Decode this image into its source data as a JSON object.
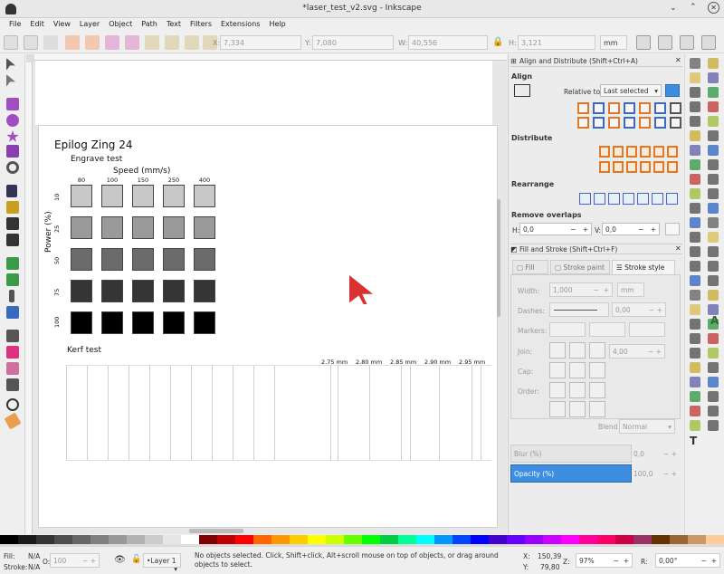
{
  "window": {
    "title": "*laser_test_v2.svg - Inkscape"
  },
  "menu": [
    "File",
    "Edit",
    "View",
    "Layer",
    "Object",
    "Path",
    "Text",
    "Filters",
    "Extensions",
    "Help"
  ],
  "toolctrl": {
    "x_label": "X:",
    "x": "7,334",
    "y_label": "Y:",
    "y": "7,080",
    "w_label": "W:",
    "w": "40,556",
    "h_label": "H:",
    "h": "3,121",
    "unit": "mm"
  },
  "drawing": {
    "title": "Epilog Zing 24",
    "engrave": "Engrave test",
    "speed": "Speed (mm/s)",
    "power": "Power (%)",
    "speeds": [
      "80",
      "100",
      "150",
      "250",
      "400"
    ],
    "powers": [
      "10",
      "25",
      "50",
      "75",
      "100"
    ],
    "row_colors": [
      "#c8c8c8",
      "#9a9a9a",
      "#6b6b6b",
      "#353535",
      "#000000"
    ],
    "kerf": "Kerf test",
    "kerf_labels": [
      "2.75 mm",
      "2.80 mm",
      "2.85 mm",
      "2.90 mm",
      "2.95 mm"
    ]
  },
  "align": {
    "header": "Align and Distribute (Shift+Ctrl+A)",
    "align": "Align",
    "relative_label": "Relative to:",
    "relative_value": "Last selected",
    "distribute": "Distribute",
    "rearrange": "Rearrange",
    "overlaps": "Remove overlaps",
    "h_label": "H:",
    "h_value": "0,0",
    "v_label": "V:",
    "v_value": "0,0"
  },
  "fill_stroke": {
    "header": "Fill and Stroke (Shift+Ctrl+F)",
    "tabs": [
      "Fill",
      "Stroke paint",
      "Stroke style"
    ],
    "width_label": "Width:",
    "width_value": "1,000",
    "width_unit": "mm",
    "dashes_label": "Dashes:",
    "dashes_value": "0,00",
    "markers_label": "Markers:",
    "join_label": "Join:",
    "join_value": "4,00",
    "cap_label": "Cap:",
    "order_label": "Order:",
    "blend_label": "Blend mode:",
    "blend_value": "Normal",
    "blur_label": "Blur (%)",
    "blur_value": "0,0",
    "opacity_label": "Opacity (%)",
    "opacity_value": "100,0"
  },
  "status": {
    "fill_label": "Fill:",
    "fill_value": "N/A",
    "stroke_label": "Stroke:",
    "stroke_value": "N/A",
    "o_label": "O:",
    "o_value": "100",
    "layer": "•Layer 1",
    "message": "No objects selected. Click, Shift+click, Alt+scroll mouse on top of objects, or drag around objects to select.",
    "x_label": "X:",
    "x": "150,39",
    "y_label": "Y:",
    "y": "79,80",
    "z_label": "Z:",
    "zoom": "97%",
    "r_label": "R:",
    "rotation": "0,00°"
  },
  "palette": [
    "#000000",
    "#1a1a1a",
    "#333333",
    "#4d4d4d",
    "#666666",
    "#808080",
    "#999999",
    "#b3b3b3",
    "#cccccc",
    "#e6e6e6",
    "#ffffff",
    "#800000",
    "#c00000",
    "#ff0000",
    "#ff6600",
    "#ff9900",
    "#ffcc00",
    "#ffff00",
    "#ccff00",
    "#66ff00",
    "#00ff00",
    "#00cc44",
    "#00ff99",
    "#00ffff",
    "#0099ff",
    "#0044ff",
    "#0000ff",
    "#4400cc",
    "#6600ff",
    "#9900ff",
    "#cc00ff",
    "#ff00ff",
    "#ff0099",
    "#ff0066",
    "#cc0044",
    "#993366",
    "#663300",
    "#996633",
    "#cc9966",
    "#ffcc99"
  ],
  "colors": {
    "accent": "#3d8ee0",
    "cursor": "#d93030"
  }
}
